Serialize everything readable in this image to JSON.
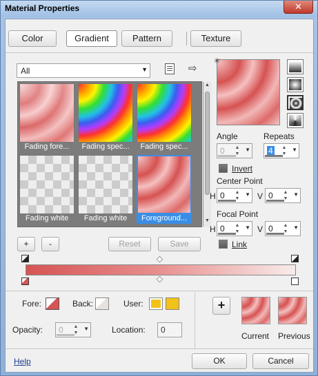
{
  "window": {
    "title": "Material Properties",
    "close_glyph": "✕"
  },
  "tabs": [
    {
      "label": "Color",
      "active": false
    },
    {
      "label": "Gradient",
      "active": true
    },
    {
      "label": "Pattern",
      "active": false
    },
    {
      "label": "Texture",
      "active": false
    }
  ],
  "category_select": {
    "value": "All"
  },
  "presets": [
    {
      "caption": "Fading fore...",
      "style": "fade-fore",
      "selected": false
    },
    {
      "caption": "Fading spec...",
      "style": "spec",
      "selected": false
    },
    {
      "caption": "Fading spec...",
      "style": "spec",
      "selected": false
    },
    {
      "caption": "Fading white",
      "style": "white",
      "selected": false
    },
    {
      "caption": "Fading white",
      "style": "white",
      "selected": false
    },
    {
      "caption": "Foreground...",
      "style": "fore",
      "selected": true
    }
  ],
  "list_buttons": {
    "add": "+",
    "remove": "-",
    "reset": "Reset",
    "save": "Save"
  },
  "icons": {
    "options": "options-icon",
    "arrow": "arrow-right-icon",
    "crosshair": "crosshair-icon"
  },
  "angle": {
    "label": "Angle",
    "value": "0"
  },
  "repeats": {
    "label": "Repeats",
    "value": "4"
  },
  "invert": {
    "label": "Invert"
  },
  "center_point": {
    "label": "Center Point",
    "h_label": "H",
    "h_value": "0",
    "v_label": "V",
    "v_value": "0"
  },
  "focal_point": {
    "label": "Focal Point",
    "h_label": "H",
    "h_value": "0",
    "v_label": "V",
    "v_value": "0"
  },
  "link": {
    "label": "Link"
  },
  "editor": {
    "fore_label": "Fore:",
    "back_label": "Back:",
    "user_label": "User:",
    "opacity_label": "Opacity:",
    "opacity_value": "0",
    "location_label": "Location:",
    "location_value": "0",
    "user_color": "#f2c21a"
  },
  "preview": {
    "add_glyph": "+",
    "current_label": "Current",
    "previous_label": "Previous"
  },
  "footer": {
    "help": "Help",
    "ok": "OK",
    "cancel": "Cancel"
  },
  "colors": {
    "accent": "#3a8ee6",
    "fore": "#d65454",
    "back": "#f7ecea"
  }
}
